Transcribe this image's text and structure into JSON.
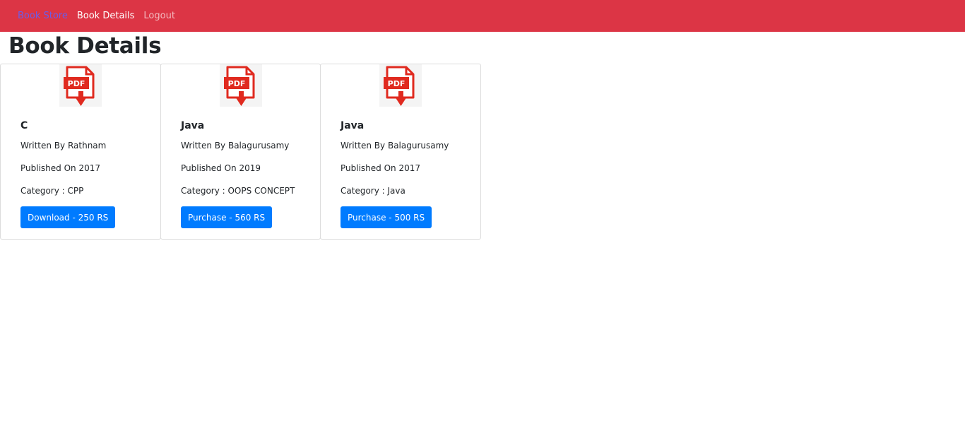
{
  "nav": {
    "brand": "Book Store",
    "active": "Book Details",
    "logout": "Logout"
  },
  "page": {
    "title": "Book Details"
  },
  "icons": {
    "book_image": "pdf-download-icon"
  },
  "colors": {
    "navbar": "#dc3545",
    "button": "#007bff",
    "pdf_red": "#e02a1f"
  },
  "books": [
    {
      "title": "C",
      "author": "Written By Rathnam",
      "published": "Published On 2017",
      "category": "Category : CPP",
      "button": "Download - 250 RS"
    },
    {
      "title": "Java",
      "author": "Written By Balagurusamy",
      "published": "Published On 2019",
      "category": "Category : OOPS CONCEPT",
      "button": "Purchase - 560 RS"
    },
    {
      "title": "Java",
      "author": "Written By Balagurusamy",
      "published": "Published On 2017",
      "category": "Category : Java",
      "button": "Purchase - 500 RS"
    }
  ]
}
